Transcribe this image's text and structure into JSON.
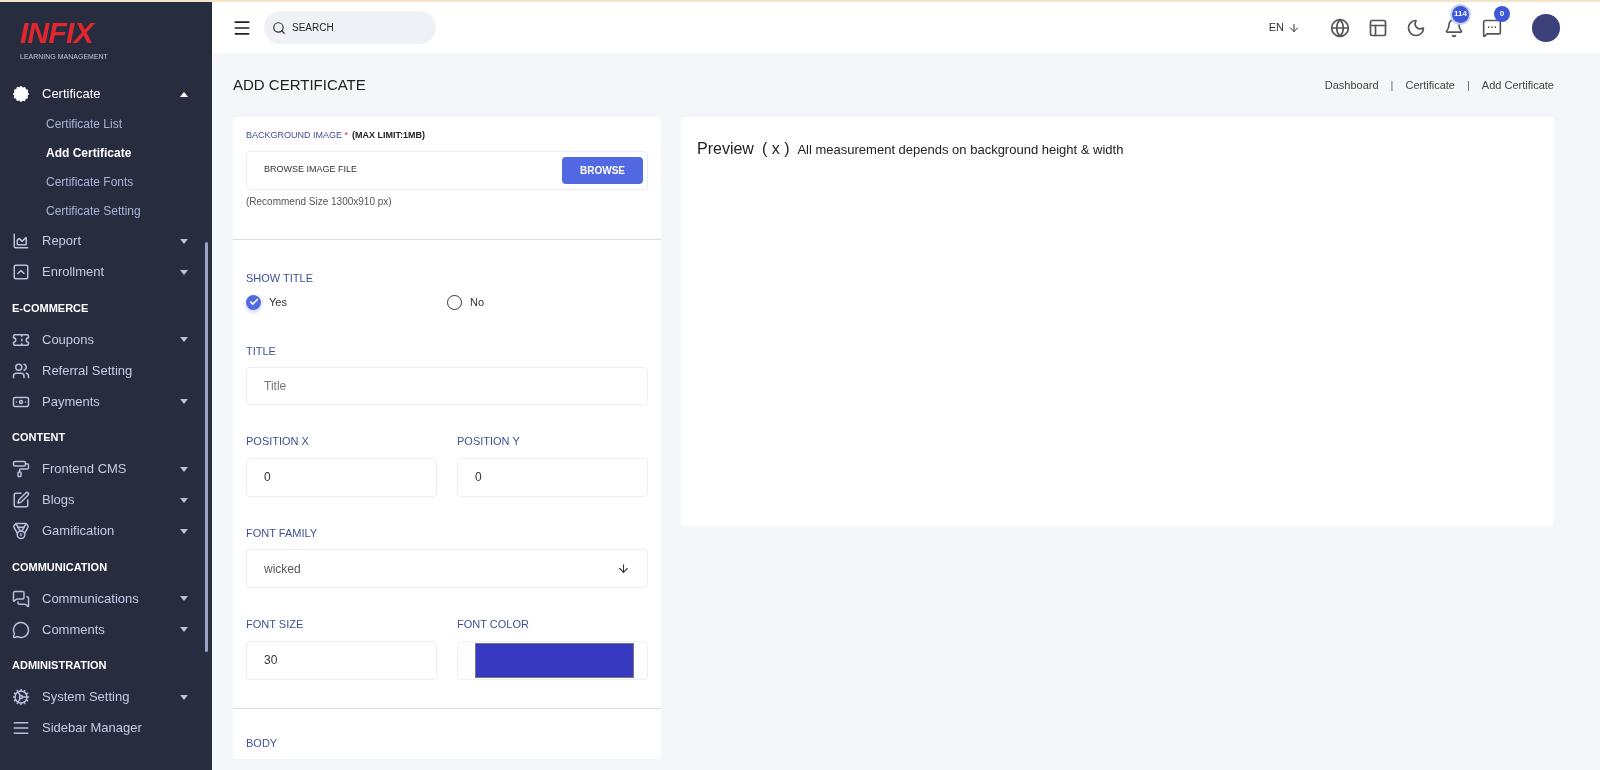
{
  "brand": {
    "logo": "INFIX",
    "tagline": "LEARNING MANAGEMENT"
  },
  "sidebar": {
    "groups": [
      {
        "items": [
          {
            "label": "Certificate",
            "expanded": true,
            "children": [
              {
                "label": "Certificate List",
                "selected": false
              },
              {
                "label": "Add Certificate",
                "selected": true
              },
              {
                "label": "Certificate Fonts",
                "selected": false
              },
              {
                "label": "Certificate Setting",
                "selected": false
              }
            ]
          },
          {
            "label": "Report",
            "expanded": false
          },
          {
            "label": "Enrollment",
            "expanded": false
          }
        ]
      },
      {
        "heading": "E-COMMERCE",
        "items": [
          {
            "label": "Coupons",
            "expanded": false
          },
          {
            "label": "Referral Setting"
          },
          {
            "label": "Payments",
            "expanded": false
          }
        ]
      },
      {
        "heading": "CONTENT",
        "items": [
          {
            "label": "Frontend CMS",
            "expanded": false
          },
          {
            "label": "Blogs",
            "expanded": false
          },
          {
            "label": "Gamification",
            "expanded": false
          }
        ]
      },
      {
        "heading": "COMMUNICATION",
        "items": [
          {
            "label": "Communications",
            "expanded": false
          },
          {
            "label": "Comments",
            "expanded": false
          }
        ]
      },
      {
        "heading": "ADMINISTRATION",
        "items": [
          {
            "label": "System Setting",
            "expanded": false
          },
          {
            "label": "Sidebar Manager"
          }
        ]
      }
    ]
  },
  "topbar": {
    "search": {
      "placeholder": "SEARCH"
    },
    "language": "EN",
    "notifications": "114",
    "messages": "0"
  },
  "page": {
    "title": "ADD CERTIFICATE",
    "breadcrumb": [
      "Dashboard",
      "Certificate",
      "Add Certificate"
    ],
    "separator": "|"
  },
  "form": {
    "background_image": {
      "label": "BACKGROUND IMAGE",
      "required_mark": "*",
      "limit": "(MAX LIMIT:1MB)",
      "file_placeholder": "BROWSE IMAGE FILE",
      "browse_button": "BROWSE",
      "hint": "(Recommend Size 1300x910 px)"
    },
    "show_title": {
      "label": "SHOW TITLE",
      "options": [
        {
          "label": "Yes",
          "selected": true
        },
        {
          "label": "No",
          "selected": false
        }
      ]
    },
    "title": {
      "label": "TITLE",
      "placeholder": "Title"
    },
    "position_x": {
      "label": "POSITION X",
      "value": "0"
    },
    "position_y": {
      "label": "POSITION Y",
      "value": "0"
    },
    "font_family": {
      "label": "FONT FAMILY",
      "value": "wicked"
    },
    "font_size": {
      "label": "FONT SIZE",
      "value": "30"
    },
    "font_color": {
      "label": "FONT COLOR",
      "color": "#373ac0"
    },
    "body": {
      "label": "BODY"
    }
  },
  "preview": {
    "title": "Preview",
    "marker": "( x )",
    "note": "All measurement depends on background height & width"
  }
}
